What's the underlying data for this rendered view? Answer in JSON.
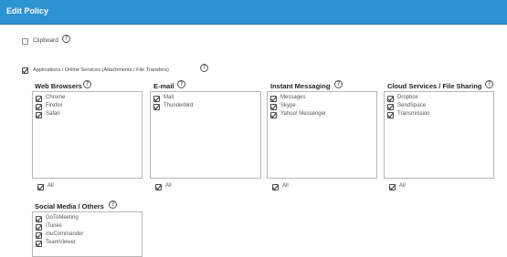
{
  "header": {
    "title": "Edit Policy"
  },
  "clipboard": {
    "label": "Clipboard",
    "checked": false
  },
  "apps": {
    "label": "Applications / Online Services (Attachments / File Transfers)",
    "checked": true
  },
  "all_label": "All",
  "categories": [
    {
      "title": "Web Browsers",
      "items": [
        "Chrome",
        "Firefox",
        "Safari"
      ]
    },
    {
      "title": "E-mail",
      "items": [
        "Mail",
        "Thunderbird"
      ]
    },
    {
      "title": "Instant Messaging",
      "items": [
        "Messages",
        "Skype",
        "Yahoo! Messenger"
      ]
    },
    {
      "title": "Cloud Services / File Sharing",
      "items": [
        "Dropbox",
        "SendSpace",
        "Transmission"
      ]
    },
    {
      "title": "Social Media / Others",
      "items": [
        "GoToMeeting",
        "iTunes",
        "muCommander",
        "TeamViewer"
      ]
    }
  ],
  "help_icon_glyph": "?"
}
